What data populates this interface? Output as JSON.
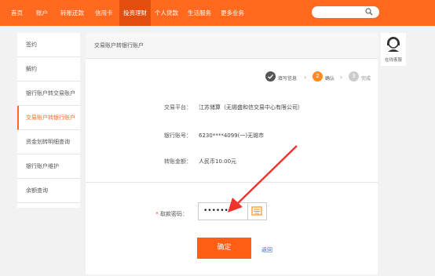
{
  "nav": {
    "items": [
      {
        "label": "首页"
      },
      {
        "label": "账户"
      },
      {
        "label": "转账还款"
      },
      {
        "label": "信用卡"
      },
      {
        "label": "投资理财"
      },
      {
        "label": "个人贷款"
      },
      {
        "label": "生活服务"
      },
      {
        "label": "更多业务"
      }
    ],
    "active_index": 4
  },
  "sidebar": {
    "items": [
      {
        "label": "签约"
      },
      {
        "label": "解约"
      },
      {
        "label": "银行账户转交易账户"
      },
      {
        "label": "交易账户转银行账户"
      },
      {
        "label": "资金划转明细查询"
      },
      {
        "label": "银行账户维护"
      },
      {
        "label": "余额查询"
      }
    ],
    "active_index": 3
  },
  "main": {
    "title": "交易账户转银行账户",
    "steps": [
      {
        "num": "",
        "label": "填写信息"
      },
      {
        "num": "2",
        "label": "确认"
      },
      {
        "num": "3",
        "label": "完成"
      }
    ],
    "fields": [
      {
        "label": "交易平台：",
        "value": "江苏储算（无锡盛和信交易中心有限公司）"
      },
      {
        "label": "银行账号：",
        "value": "6230****4099(一)无锡市"
      },
      {
        "label": "转账金额：",
        "value": "人民币10.00元"
      }
    ],
    "password": {
      "label": "取款密码：",
      "required_mark": "*",
      "value": "••••••"
    },
    "confirm_label": "确定",
    "back_label": "返回"
  },
  "service": {
    "label": "在线客服"
  },
  "colors": {
    "accent": "#ff6a1f",
    "active_nav": "#e24e0e",
    "step_done": "#555555",
    "step_current": "#ff8a1f",
    "step_pending": "#cccccc",
    "arrow": "#f0322c",
    "link": "#2b6bd2"
  }
}
